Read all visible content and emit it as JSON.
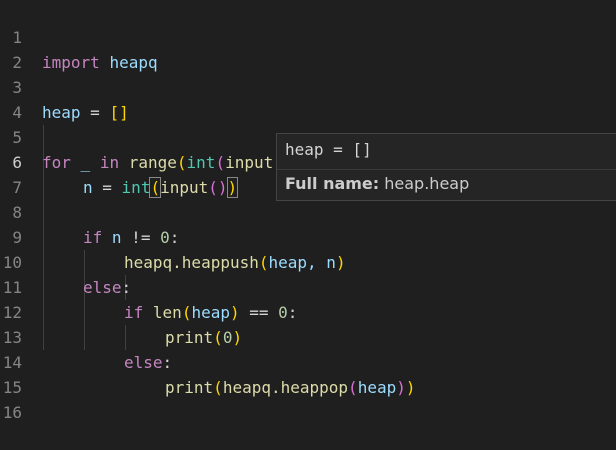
{
  "editor": {
    "active_line": 6,
    "lines": [
      {
        "n": "1"
      },
      {
        "n": "2"
      },
      {
        "n": "3"
      },
      {
        "n": "4"
      },
      {
        "n": "5"
      },
      {
        "n": "6"
      },
      {
        "n": "7"
      },
      {
        "n": "8"
      },
      {
        "n": "9"
      },
      {
        "n": "10"
      },
      {
        "n": "11"
      },
      {
        "n": "12"
      },
      {
        "n": "13"
      },
      {
        "n": "14"
      },
      {
        "n": "15"
      },
      {
        "n": "16"
      }
    ],
    "tokens": {
      "import": "import",
      "heapq": "heapq",
      "heap": "heap",
      "eq": " = ",
      "list_open": "[",
      "list_close": "]",
      "for": "for",
      "underscore": " _ ",
      "in": "in",
      "space": " ",
      "range": "range",
      "int": "int",
      "input": "input",
      "po": "(",
      "pc": ")",
      "colon": ":",
      "n": "n",
      "if": "if",
      "ne": " != ",
      "zero": "0",
      "heapq_heappush": "heapq.heappush",
      "comma_n": ", n",
      "else": "else",
      "len": "len",
      "eqeq": " == ",
      "print": "print",
      "heapq_heappop": "heapq.heappop"
    }
  },
  "hover": {
    "signature": "heap = []",
    "full_name_label": "Full name:",
    "full_name_value": "heap.heap"
  }
}
